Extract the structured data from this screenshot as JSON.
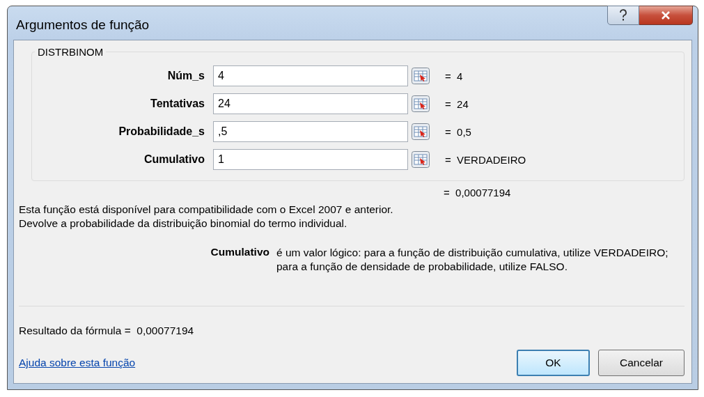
{
  "window": {
    "title": "Argumentos de função"
  },
  "function": {
    "name": "DISTRBINOM",
    "arguments": [
      {
        "label": "Núm_s",
        "value": "4",
        "result": "=  4"
      },
      {
        "label": "Tentativas",
        "value": "24",
        "result": "=  24"
      },
      {
        "label": "Probabilidade_s",
        "value": ",5",
        "result": "=  0,5"
      },
      {
        "label": "Cumulativo",
        "value": "1",
        "result": "=  VERDADEIRO"
      }
    ],
    "result": "=  0,00077194",
    "description": [
      "Esta função está disponível para compatibilidade com o Excel 2007 e anterior.",
      "Devolve a probabilidade da distribuição binomial do termo individual."
    ],
    "argument_help": {
      "label": "Cumulativo",
      "text": "é um valor lógico: para a função de distribuição cumulativa, utilize VERDADEIRO; para a função de densidade de probabilidade, utilize FALSO."
    }
  },
  "formula_result": {
    "label": "Resultado da fórmula =",
    "value": "0,00077194"
  },
  "help_link": "Ajuda sobre esta função",
  "buttons": [
    {
      "label": "OK",
      "default": true
    },
    {
      "label": "Cancelar",
      "default": false
    }
  ]
}
